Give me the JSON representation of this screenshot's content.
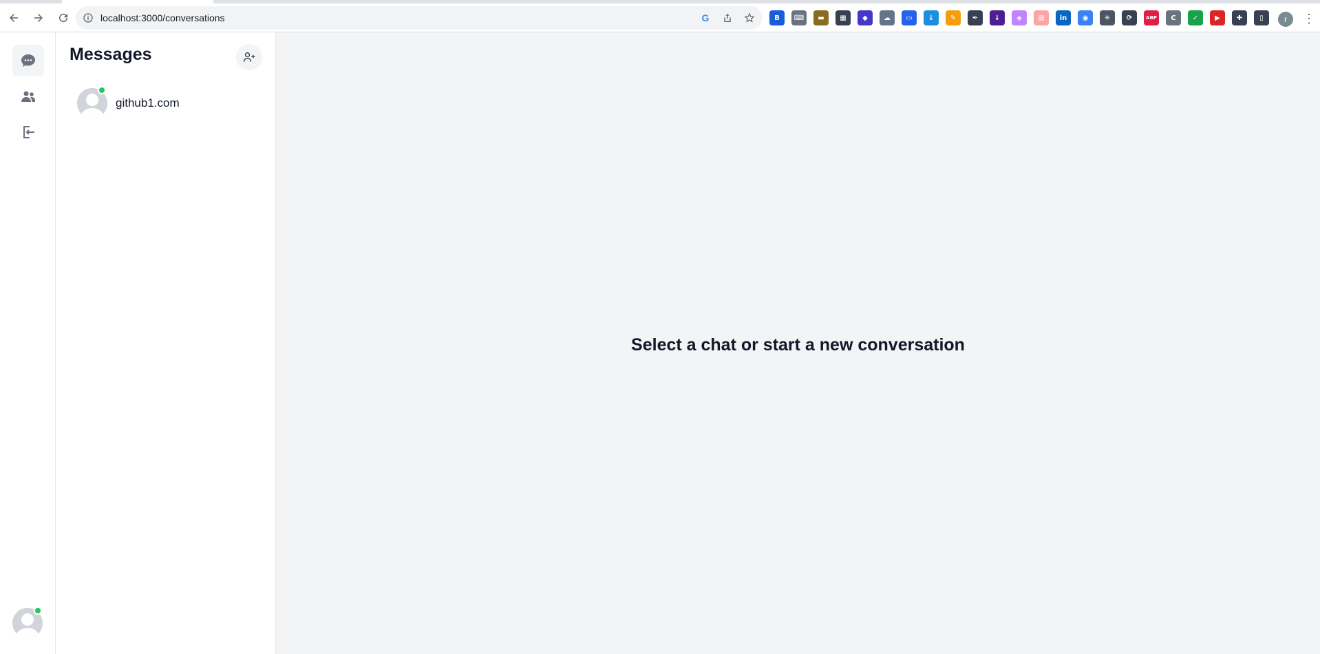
{
  "browser": {
    "url": "localhost:3000/conversations",
    "profile_initial": "r",
    "extensions": [
      {
        "name": "bitwarden-icon",
        "color": "#175ddc",
        "glyph": "B"
      },
      {
        "name": "keyboard-icon",
        "color": "#6b7280",
        "glyph": "⌨"
      },
      {
        "name": "cake-icon",
        "color": "#8b6b1f",
        "glyph": "▬"
      },
      {
        "name": "qr-icon",
        "color": "#374151",
        "glyph": "▦"
      },
      {
        "name": "stack-icon",
        "color": "#4338ca",
        "glyph": "◆"
      },
      {
        "name": "cloud-off-icon",
        "color": "#64748b",
        "glyph": "☁"
      },
      {
        "name": "chat-ext-icon",
        "color": "#2563eb",
        "glyph": "▭"
      },
      {
        "name": "download-icon",
        "color": "#1d8fe1",
        "glyph": "↓"
      },
      {
        "name": "pencil-icon",
        "color": "#f59e0b",
        "glyph": "✎"
      },
      {
        "name": "pen-tool-icon",
        "color": "#374151",
        "glyph": "✒"
      },
      {
        "name": "downloader-icon",
        "color": "#4c1d95",
        "glyph": "↓"
      },
      {
        "name": "gradient-icon",
        "color": "#c084fc",
        "glyph": "◈"
      },
      {
        "name": "calendar-icon",
        "color": "#fca5a5",
        "glyph": "▤"
      },
      {
        "name": "linkedin-icon",
        "color": "#0a66c2",
        "glyph": "in"
      },
      {
        "name": "camera-icon",
        "color": "#3b82f6",
        "glyph": "◉"
      },
      {
        "name": "bug-icon",
        "color": "#4b5563",
        "glyph": "✳"
      },
      {
        "name": "sync-icon",
        "color": "#374151",
        "glyph": "⟳"
      },
      {
        "name": "adblock-icon",
        "color": "#e11d48",
        "glyph": "ABP"
      },
      {
        "name": "cookie-icon",
        "color": "#6b7280",
        "glyph": "C"
      },
      {
        "name": "shield-check-icon",
        "color": "#16a34a",
        "glyph": "✓"
      },
      {
        "name": "video-off-icon",
        "color": "#dc2626",
        "glyph": "▶"
      },
      {
        "name": "puzzle-icon",
        "color": "#374151",
        "glyph": "✚"
      },
      {
        "name": "sidepanel-icon",
        "color": "#374151",
        "glyph": "▯"
      }
    ]
  },
  "sidebar": {
    "title": "Messages"
  },
  "conversations": [
    {
      "name": "github1.com",
      "online": true
    }
  ],
  "main": {
    "empty_message": "Select a chat or start a new conversation"
  },
  "colors": {
    "online": "#22c55e",
    "main_bg": "#f3f4f6",
    "text": "#111827"
  }
}
